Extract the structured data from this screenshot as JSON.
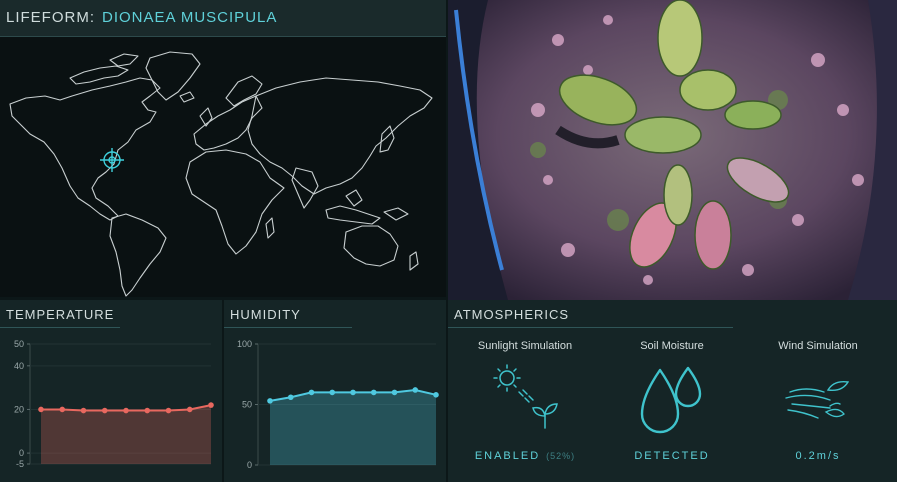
{
  "header": {
    "label": "LIFEFORM:",
    "value": "DIONAEA MUSCIPULA"
  },
  "photo": {
    "subject": "venus-flytrap-photo"
  },
  "temperature": {
    "title": "TEMPERATURE",
    "chart_data": {
      "type": "area",
      "yticks": [
        "50",
        "40",
        "20",
        "0",
        "-5"
      ],
      "ylim": [
        -5,
        50
      ],
      "values": [
        20,
        20,
        19.5,
        19.5,
        19.5,
        19.5,
        19.5,
        20,
        22
      ],
      "color": "#e8685f"
    }
  },
  "humidity": {
    "title": "HUMIDITY",
    "chart_data": {
      "type": "area",
      "yticks": [
        "100",
        "50",
        "0"
      ],
      "ylim": [
        0,
        100
      ],
      "values": [
        53,
        56,
        60,
        60,
        60,
        60,
        60,
        62,
        58
      ],
      "color": "#4fc9e0"
    }
  },
  "atmospherics": {
    "title": "ATMOSPHERICS",
    "sunlight": {
      "name": "Sunlight Simulation",
      "status": "ENABLED",
      "sub": "(52%)"
    },
    "soil": {
      "name": "Soil Moisture",
      "status": "DETECTED"
    },
    "wind": {
      "name": "Wind Simulation",
      "status": "0.2m/s"
    }
  },
  "colors": {
    "accent": "#5fd1d9",
    "temp": "#e8685f",
    "humidity": "#4fc9e0"
  }
}
